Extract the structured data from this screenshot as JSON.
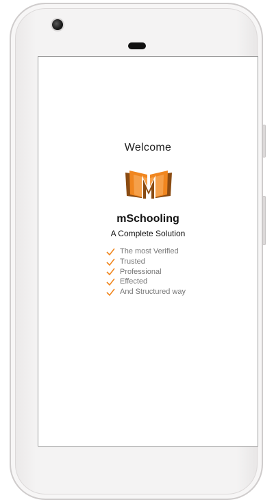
{
  "screen": {
    "welcome": "Welcome",
    "app_name": "mSchooling",
    "tagline": "A Complete Solution",
    "features": [
      "The most Verified",
      "Trusted",
      "Professional",
      "Effected",
      "And Structured way"
    ]
  },
  "icons": {
    "logo": "open-book-logo-icon",
    "feature_check": "checkmark-icon"
  },
  "colors": {
    "accent": "#f0861f",
    "accent_dark": "#8a4b12",
    "feature_text": "#777777",
    "text": "#111111"
  }
}
